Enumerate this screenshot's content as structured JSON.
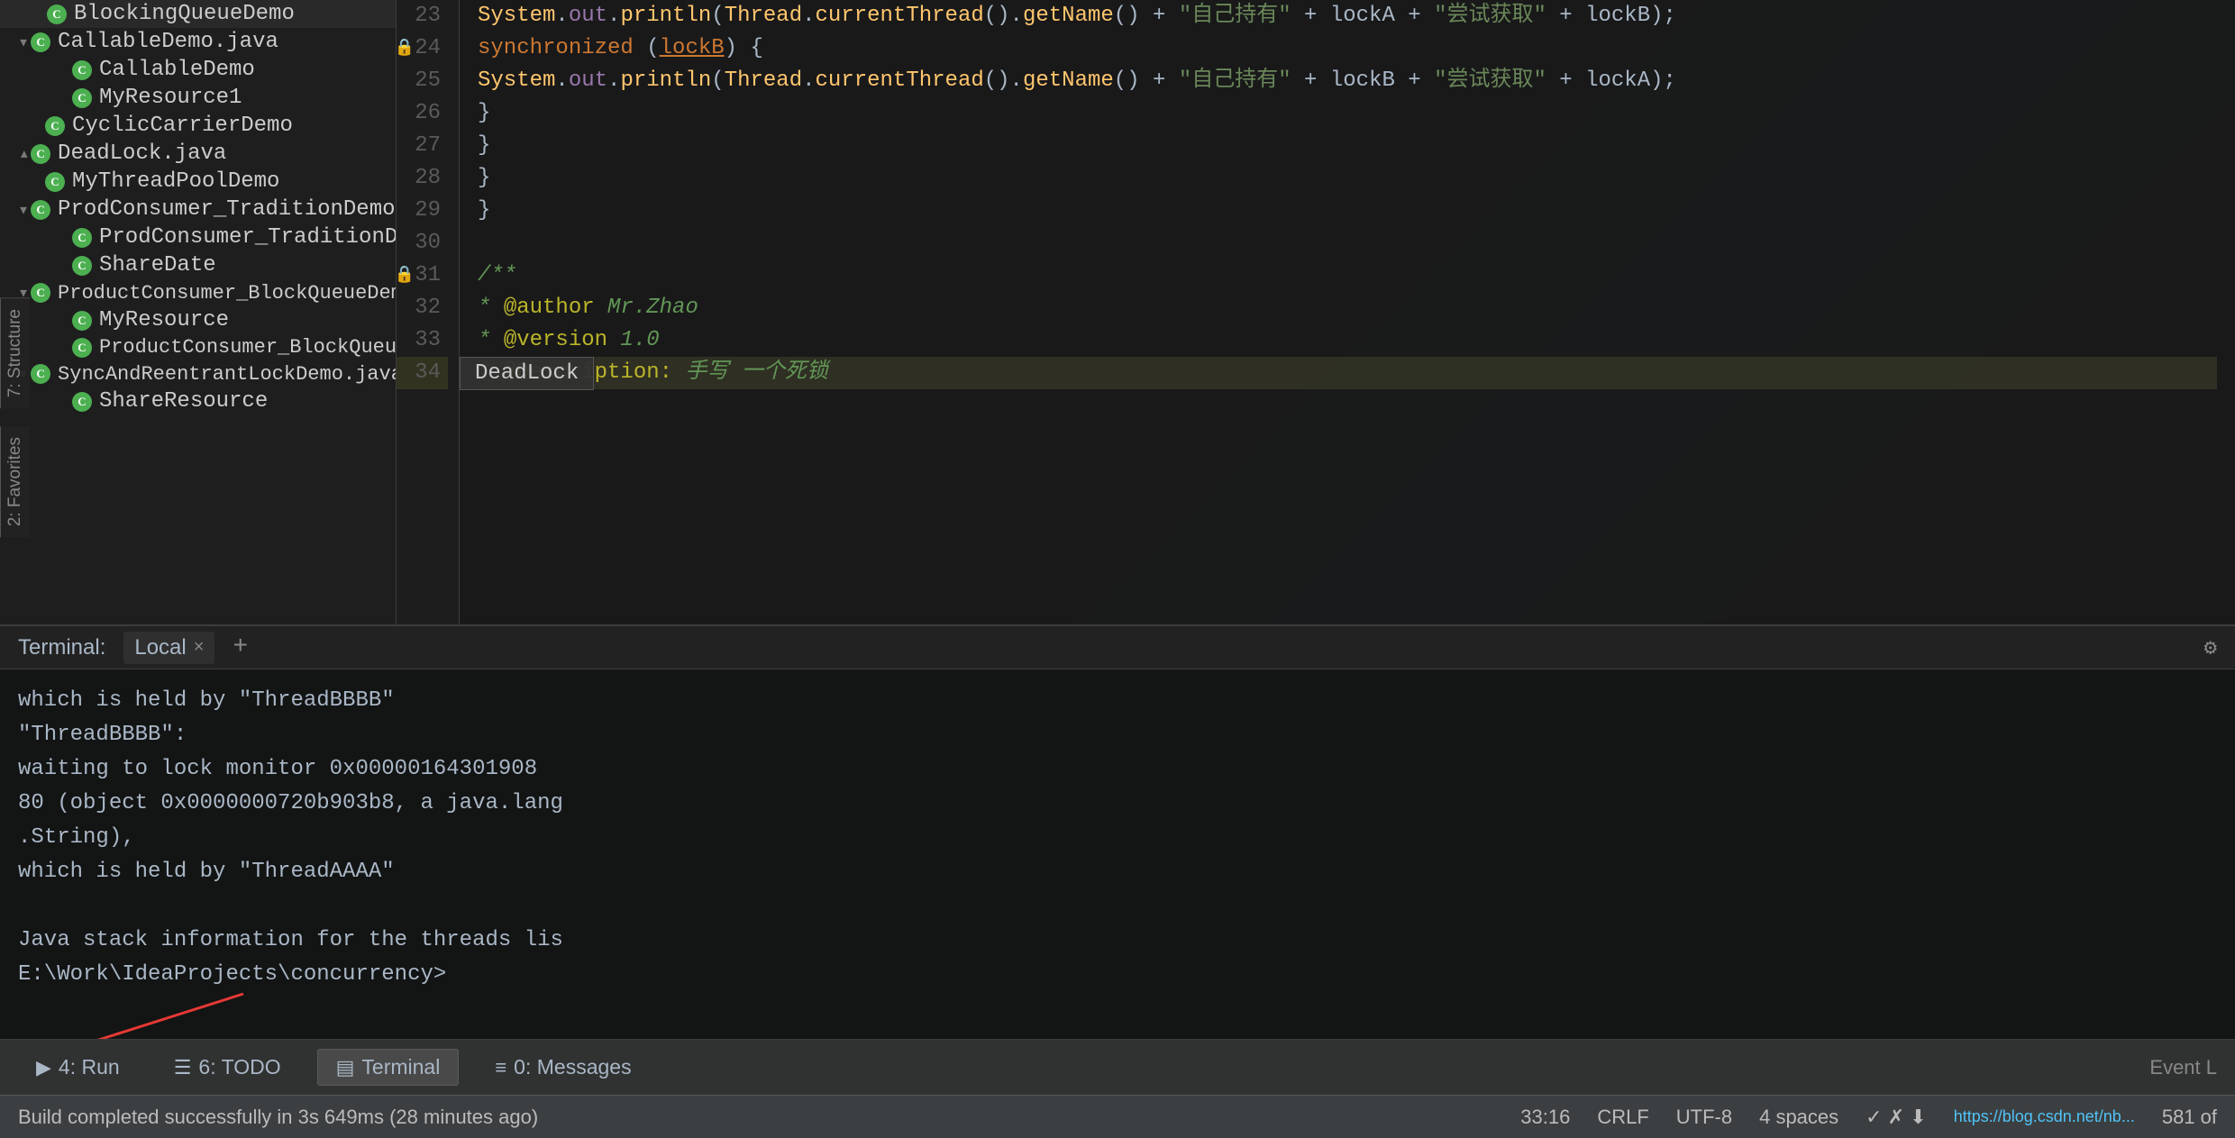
{
  "sidebar": {
    "items": [
      {
        "label": "BlockingQueueDemo",
        "level": 2,
        "type": "java",
        "expanded": false,
        "arrow": ""
      },
      {
        "label": "CallableDemo.java",
        "level": 2,
        "type": "java",
        "expanded": true,
        "arrow": "▾"
      },
      {
        "label": "CallableDemo",
        "level": 3,
        "type": "java"
      },
      {
        "label": "MyResource1",
        "level": 3,
        "type": "java"
      },
      {
        "label": "CyclicCarrierDemo",
        "level": 2,
        "type": "java"
      },
      {
        "label": "DeadLock.java",
        "level": 2,
        "type": "java",
        "expanded": false,
        "arrow": "▸"
      },
      {
        "label": "MyThreadPoolDemo",
        "level": 2,
        "type": "java"
      },
      {
        "label": "ProdConsumer_TraditionDemo.java",
        "level": 2,
        "type": "java",
        "expanded": true,
        "arrow": "▾"
      },
      {
        "label": "ProdConsumer_TraditionDemo",
        "level": 3,
        "type": "java"
      },
      {
        "label": "ShareDate",
        "level": 3,
        "type": "java"
      },
      {
        "label": "ProductConsumer_BlockQueueDemo.java",
        "level": 2,
        "type": "java",
        "expanded": true,
        "arrow": "▾"
      },
      {
        "label": "MyResource",
        "level": 3,
        "type": "java"
      },
      {
        "label": "ProductConsumer_BlockQueueDemo",
        "level": 3,
        "type": "java"
      },
      {
        "label": "SyncAndReentrantLockDemo.java",
        "level": 2,
        "type": "java",
        "expanded": true,
        "arrow": "▾"
      },
      {
        "label": "ShareResource",
        "level": 3,
        "type": "java"
      }
    ]
  },
  "editor": {
    "lines": [
      {
        "num": 23,
        "content": "System.out.println(Thread.currentThread().getName() + \"自己持有\" + lockA + \"尝试获取\" + lockB);",
        "gutter": ""
      },
      {
        "num": 24,
        "content": "synchronized (lockB) {",
        "gutter": "lock"
      },
      {
        "num": 25,
        "content": "    System.out.println(Thread.currentThread().getName() + \"自己持有\" + lockB + \"尝试获取\" + lockA);",
        "gutter": ""
      },
      {
        "num": 26,
        "content": "}",
        "gutter": ""
      },
      {
        "num": 27,
        "content": "}",
        "gutter": ""
      },
      {
        "num": 28,
        "content": "}",
        "gutter": ""
      },
      {
        "num": 29,
        "content": "}",
        "gutter": ""
      },
      {
        "num": 30,
        "content": "",
        "gutter": ""
      },
      {
        "num": 31,
        "content": "/**",
        "gutter": "lock"
      },
      {
        "num": 32,
        "content": " * @author Mr.Zhao",
        "gutter": ""
      },
      {
        "num": 33,
        "content": " * @version 1.0",
        "gutter": ""
      },
      {
        "num": 34,
        "content": " * @Description: 手写  一个死锁",
        "gutter": "",
        "highlight": true
      }
    ],
    "tooltip": "DeadLock"
  },
  "terminal": {
    "label": "Terminal:",
    "tab_local": "Local",
    "tab_close": "×",
    "tab_add": "+",
    "lines": [
      "  which is held by \"ThreadBBBB\"",
      "\"ThreadBBBB\":",
      "  waiting to lock monitor 0x00000164301908",
      "80 (object 0x0000000720b903b8, a java.lang",
      ".String),",
      "  which is held by \"ThreadAAAA\"",
      "",
      "Java stack information for the threads lis",
      "E:\\Work\\IdeaProjects\\concurrency>"
    ]
  },
  "bottom_tabs": [
    {
      "label": "4: Run",
      "icon": "▶",
      "active": false
    },
    {
      "label": "6: TODO",
      "icon": "☰",
      "active": false
    },
    {
      "label": "Terminal",
      "icon": "▤",
      "active": true
    },
    {
      "label": "0: Messages",
      "icon": "≡",
      "active": false
    }
  ],
  "status_bar": {
    "message": "Build completed successfully in 3s 649ms (28 minutes ago)",
    "position": "33:16",
    "line_ending": "CRLF",
    "encoding": "UTF-8",
    "indent": "4 spaces",
    "page_count": "581 of"
  },
  "event_log": "Event L",
  "url": "https://blog.csdn.net/nb...",
  "structure_label": "7: Structure",
  "favorites_label": "2: Favorites",
  "vertical_labels": [
    "7: Structure",
    "2: Favorites"
  ]
}
